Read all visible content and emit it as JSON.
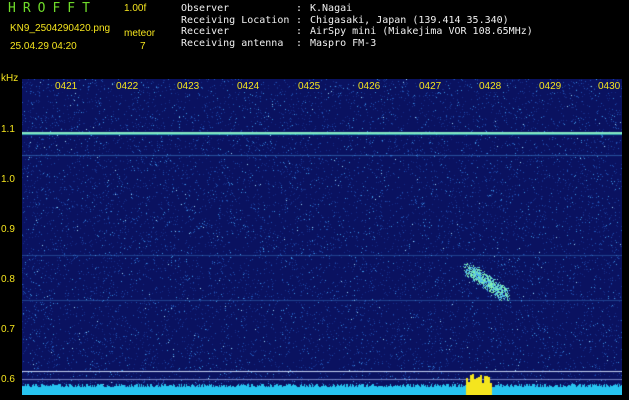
{
  "header": {
    "app_title": "HROFFT",
    "version": "1.00f",
    "filename": "KN9_2504290420.png",
    "datetime": "25.04.29 04:20",
    "counter_label": "meteor",
    "counter_value": "7"
  },
  "metadata": [
    {
      "key": "Observer",
      "sep": ":",
      "value": "K.Nagai"
    },
    {
      "key": "Receiving Location",
      "sep": ":",
      "value": "Chigasaki, Japan (139.414 35.340)"
    },
    {
      "key": "Receiver",
      "sep": ":",
      "value": "AirSpy mini (Miakejima VOR 108.65MHz)"
    },
    {
      "key": "Receiving antenna",
      "sep": ":",
      "value": "Maspro FM-3"
    }
  ],
  "spectrogram": {
    "unit_label": "kHz",
    "y_ticks": [
      "1.1",
      "1.0",
      "0.9",
      "0.8",
      "0.7",
      "0.6"
    ],
    "time_ticks": [
      "0421",
      "0422",
      "0423",
      "0424",
      "0425",
      "0426",
      "0427",
      "0428",
      "0429",
      "0430"
    ],
    "colors": {
      "background": "#0a1260",
      "noise": "#2a7cd6",
      "carrier": "#8df5c8",
      "signal_bar": "#27c4f0",
      "tick_label": "#f5e51e"
    }
  }
}
